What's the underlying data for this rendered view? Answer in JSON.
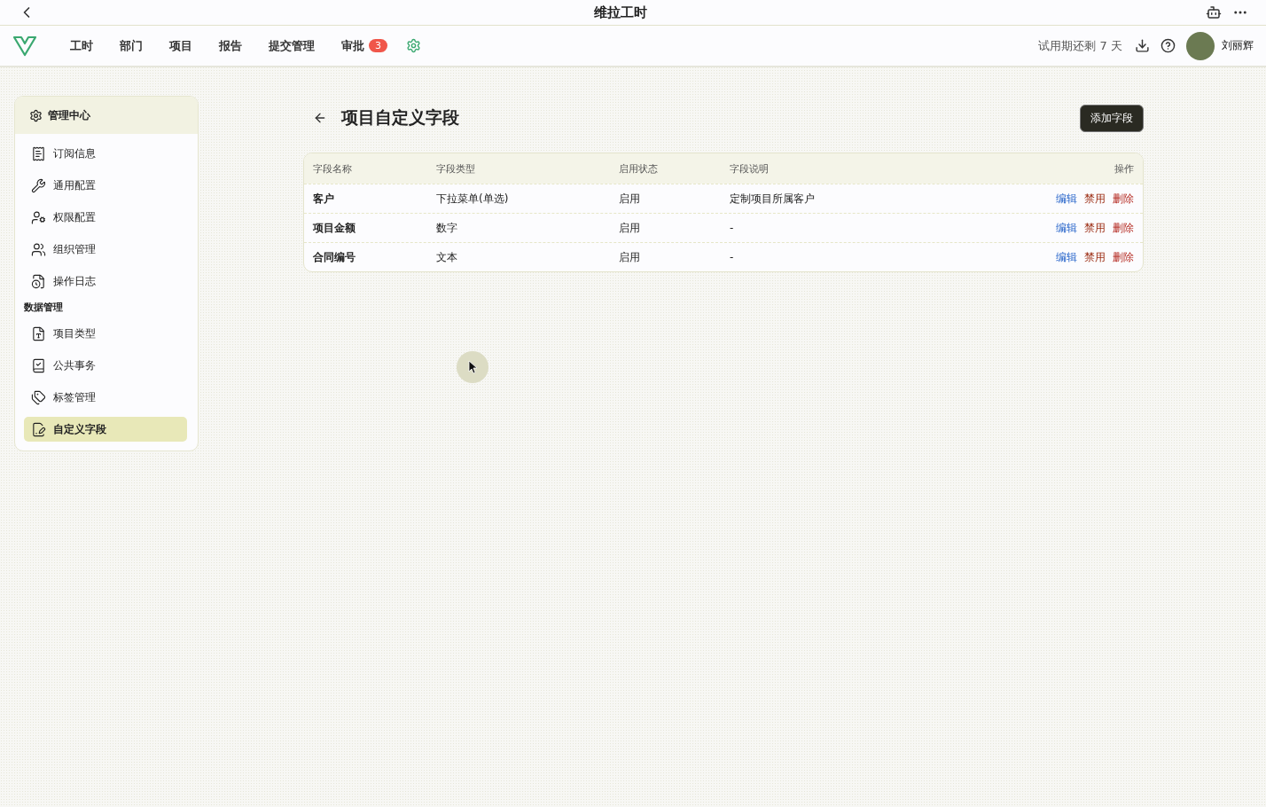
{
  "window": {
    "title": "维拉工时"
  },
  "nav": {
    "tabs": [
      {
        "label": "工时"
      },
      {
        "label": "部门"
      },
      {
        "label": "项目"
      },
      {
        "label": "报告"
      },
      {
        "label": "提交管理"
      },
      {
        "label": "审批",
        "badge": "3"
      }
    ],
    "trial": "试用期还剩 7 天",
    "user": "刘丽辉"
  },
  "sidebar": {
    "title": "管理中心",
    "items": [
      {
        "kind": "item",
        "label": "订阅信息",
        "selected": false
      },
      {
        "kind": "item",
        "label": "通用配置",
        "selected": false
      },
      {
        "kind": "item",
        "label": "权限配置",
        "selected": false
      },
      {
        "kind": "item",
        "label": "组织管理",
        "selected": false
      },
      {
        "kind": "item",
        "label": "操作日志",
        "selected": false
      },
      {
        "kind": "section",
        "label": "数据管理"
      },
      {
        "kind": "item",
        "label": "项目类型",
        "selected": false
      },
      {
        "kind": "item",
        "label": "公共事务",
        "selected": false
      },
      {
        "kind": "item",
        "label": "标签管理",
        "selected": false
      },
      {
        "kind": "item",
        "label": "自定义字段",
        "selected": true
      }
    ]
  },
  "page": {
    "title": "项目自定义字段",
    "add_button": "添加字段"
  },
  "table": {
    "columns": [
      "字段名称",
      "字段类型",
      "启用状态",
      "字段说明",
      "操作"
    ],
    "rows": [
      {
        "name": "客户",
        "type": "下拉菜单(单选)",
        "status": "启用",
        "description": "定制项目所属客户",
        "actions": [
          "编辑",
          "禁用",
          "删除"
        ]
      },
      {
        "name": "项目金额",
        "type": "数字",
        "status": "启用",
        "description": "-",
        "actions": [
          "编辑",
          "禁用",
          "删除"
        ]
      },
      {
        "name": "合同编号",
        "type": "文本",
        "status": "启用",
        "description": "-",
        "actions": [
          "编辑",
          "禁用",
          "删除"
        ]
      }
    ]
  }
}
